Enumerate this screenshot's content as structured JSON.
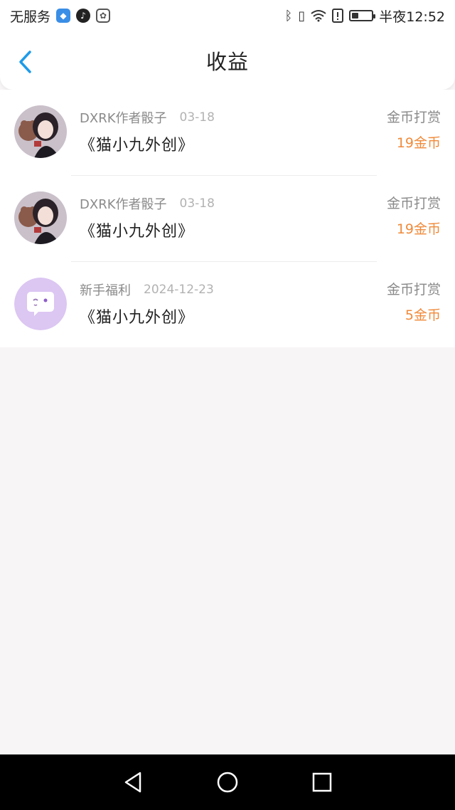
{
  "status_bar": {
    "carrier": "无服务",
    "time": "半夜12:52",
    "battery_level": 0.35,
    "icons": [
      "shield-icon",
      "tiktok-icon",
      "baidu-paw-icon",
      "bluetooth-icon",
      "vibrate-icon",
      "wifi-icon",
      "alert-icon",
      "battery-icon"
    ]
  },
  "header": {
    "title": "收益",
    "back_icon": "chevron-left-icon"
  },
  "colors": {
    "accent_blue": "#1e9be9",
    "amount_orange": "#f08a3a",
    "background": "#f7f5f6"
  },
  "earnings": [
    {
      "author": "DXRK作者骰子",
      "date": "03-18",
      "work": "《猫小九外创》",
      "type": "金币打赏",
      "amount": "19金币",
      "avatar": "anime-girl-avatar"
    },
    {
      "author": "DXRK作者骰子",
      "date": "03-18",
      "work": "《猫小九外创》",
      "type": "金币打赏",
      "amount": "19金币",
      "avatar": "anime-girl-avatar"
    },
    {
      "author": "新手福利",
      "date": "2024-12-23",
      "work": "《猫小九外创》",
      "type": "金币打赏",
      "amount": "5金币",
      "avatar": "chat-bubble-avatar"
    }
  ],
  "nav_bar": {
    "buttons": [
      "back-triangle-icon",
      "home-circle-icon",
      "recents-square-icon"
    ]
  }
}
